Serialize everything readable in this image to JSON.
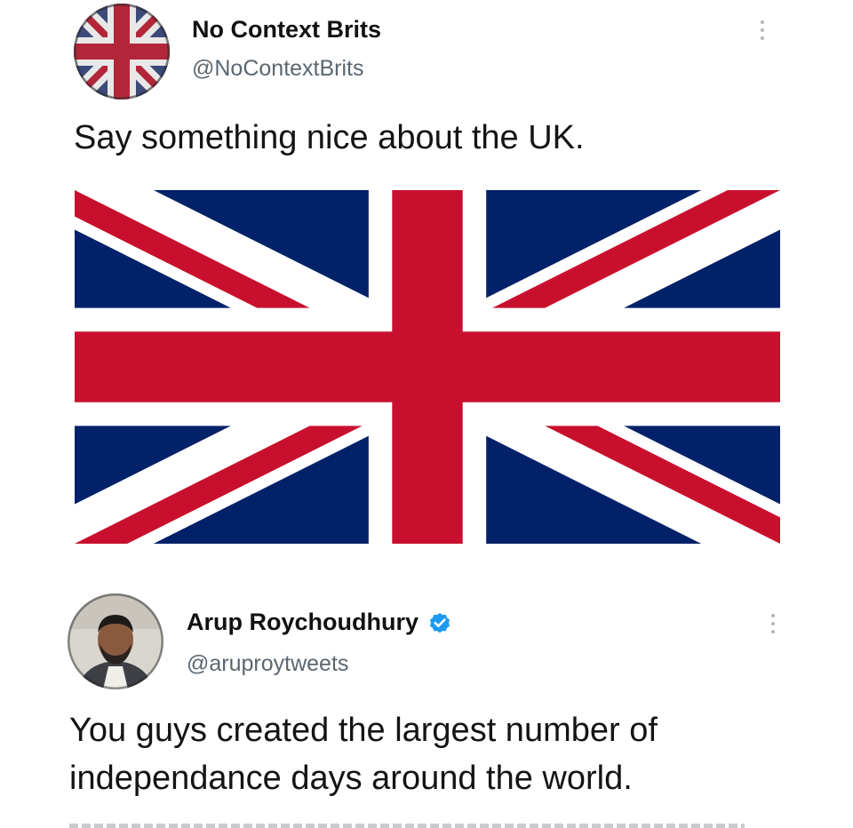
{
  "tweets": [
    {
      "display_name": "No Context Brits",
      "handle": "@NoContextBrits",
      "verified": false,
      "text": "Say something nice about the UK.",
      "media": "union-jack-flag",
      "avatar": "union-jack-avatar"
    },
    {
      "display_name": "Arup Roychoudhury",
      "handle": "@aruproytweets",
      "verified": true,
      "text_lines": [
        "You guys created the largest number of",
        "independance days around the world."
      ],
      "avatar": "person-photo-avatar"
    }
  ],
  "colors": {
    "flag_blue": "#012169",
    "flag_red": "#C8102E",
    "verified_blue": "#1d9bf0",
    "handle_gray": "#5b6670"
  },
  "icons": {
    "more": "more-vertical-icon",
    "verified": "verified-badge-icon"
  }
}
